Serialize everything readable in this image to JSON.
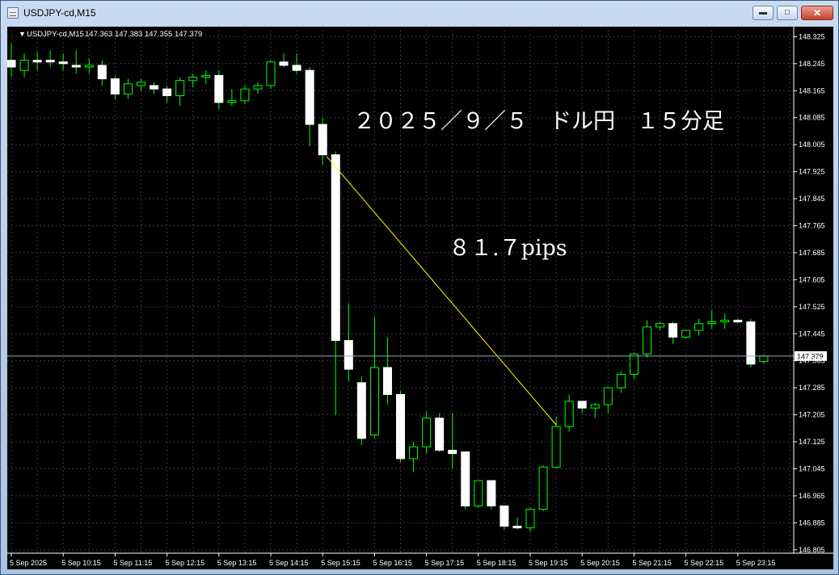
{
  "window": {
    "title": "USDJPY-cd,M15",
    "buttons": {
      "minimize": "▬",
      "maximize": "□",
      "close": "✕"
    }
  },
  "chart_data": {
    "type": "candlestick",
    "symbol_label": "USDJPY-cd,M15",
    "ohlc_header": "147.363 147.383 147.355 147.379",
    "title": "２０２５／９／５　ドル円　１５分足",
    "annotation": "８１.７pips",
    "current_price_label": "147.379",
    "current_price": 147.379,
    "ylim": [
      146.795,
      148.345
    ],
    "y_ticks": [
      "148.325",
      "148.245",
      "148.165",
      "148.085",
      "148.005",
      "147.925",
      "147.845",
      "147.765",
      "147.685",
      "147.605",
      "147.525",
      "147.445",
      "147.365",
      "147.285",
      "147.205",
      "147.125",
      "147.045",
      "146.965",
      "146.885",
      "146.805"
    ],
    "x_ticks": [
      "5 Sep 2025",
      "5 Sep 10:15",
      "5 Sep 11:15",
      "5 Sep 12:15",
      "5 Sep 13:15",
      "5 Sep 14:15",
      "5 Sep 15:15",
      "5 Sep 16:15",
      "5 Sep 17:15",
      "5 Sep 18:15",
      "5 Sep 19:15",
      "5 Sep 20:15",
      "5 Sep 21:15",
      "5 Sep 22:15",
      "5 Sep 23:15"
    ],
    "trendline": {
      "from": [
        24,
        147.97
      ],
      "to": [
        42,
        147.175
      ],
      "color": "#ffff00"
    },
    "colors": {
      "background": "#000000",
      "grid": "#3a3a3a",
      "bull_wick": "#00ff00",
      "bear_wick": "#00ff00",
      "body_up": "#000000",
      "body_down": "#ffffff",
      "axis_text": "#ffffff",
      "price_line": "#8fa9c4"
    },
    "candles": [
      {
        "o": 148.255,
        "h": 148.305,
        "l": 148.205,
        "c": 148.235
      },
      {
        "o": 148.225,
        "h": 148.275,
        "l": 148.205,
        "c": 148.255
      },
      {
        "o": 148.255,
        "h": 148.28,
        "l": 148.225,
        "c": 148.25
      },
      {
        "o": 148.255,
        "h": 148.285,
        "l": 148.235,
        "c": 148.25
      },
      {
        "o": 148.25,
        "h": 148.275,
        "l": 148.225,
        "c": 148.245
      },
      {
        "o": 148.24,
        "h": 148.285,
        "l": 148.215,
        "c": 148.235
      },
      {
        "o": 148.235,
        "h": 148.26,
        "l": 148.215,
        "c": 148.24
      },
      {
        "o": 148.24,
        "h": 148.255,
        "l": 148.18,
        "c": 148.2
      },
      {
        "o": 148.2,
        "h": 148.21,
        "l": 148.14,
        "c": 148.155
      },
      {
        "o": 148.155,
        "h": 148.2,
        "l": 148.14,
        "c": 148.185
      },
      {
        "o": 148.18,
        "h": 148.2,
        "l": 148.165,
        "c": 148.19
      },
      {
        "o": 148.18,
        "h": 148.19,
        "l": 148.155,
        "c": 148.17
      },
      {
        "o": 148.17,
        "h": 148.18,
        "l": 148.13,
        "c": 148.15
      },
      {
        "o": 148.15,
        "h": 148.205,
        "l": 148.12,
        "c": 148.195
      },
      {
        "o": 148.195,
        "h": 148.215,
        "l": 148.175,
        "c": 148.205
      },
      {
        "o": 148.205,
        "h": 148.225,
        "l": 148.185,
        "c": 148.21
      },
      {
        "o": 148.21,
        "h": 148.225,
        "l": 148.11,
        "c": 148.13
      },
      {
        "o": 148.13,
        "h": 148.17,
        "l": 148.12,
        "c": 148.135
      },
      {
        "o": 148.135,
        "h": 148.18,
        "l": 148.125,
        "c": 148.17
      },
      {
        "o": 148.17,
        "h": 148.19,
        "l": 148.155,
        "c": 148.18
      },
      {
        "o": 148.18,
        "h": 148.255,
        "l": 148.17,
        "c": 148.25
      },
      {
        "o": 148.25,
        "h": 148.275,
        "l": 148.235,
        "c": 148.24
      },
      {
        "o": 148.24,
        "h": 148.275,
        "l": 148.215,
        "c": 148.225
      },
      {
        "o": 148.225,
        "h": 148.235,
        "l": 148.0,
        "c": 148.065
      },
      {
        "o": 148.065,
        "h": 148.085,
        "l": 147.945,
        "c": 147.975
      },
      {
        "o": 147.975,
        "h": 147.985,
        "l": 147.205,
        "c": 147.425
      },
      {
        "o": 147.425,
        "h": 147.535,
        "l": 147.305,
        "c": 147.34
      },
      {
        "o": 147.3,
        "h": 147.32,
        "l": 147.115,
        "c": 147.135
      },
      {
        "o": 147.145,
        "h": 147.495,
        "l": 147.135,
        "c": 147.345
      },
      {
        "o": 147.345,
        "h": 147.435,
        "l": 147.235,
        "c": 147.265
      },
      {
        "o": 147.265,
        "h": 147.275,
        "l": 147.065,
        "c": 147.075
      },
      {
        "o": 147.075,
        "h": 147.125,
        "l": 147.035,
        "c": 147.11
      },
      {
        "o": 147.11,
        "h": 147.215,
        "l": 147.09,
        "c": 147.195
      },
      {
        "o": 147.195,
        "h": 147.21,
        "l": 147.095,
        "c": 147.1
      },
      {
        "o": 147.1,
        "h": 147.21,
        "l": 147.045,
        "c": 147.09
      },
      {
        "o": 147.095,
        "h": 147.095,
        "l": 146.925,
        "c": 146.935
      },
      {
        "o": 146.935,
        "h": 147.005,
        "l": 146.93,
        "c": 147.01
      },
      {
        "o": 147.01,
        "h": 147.005,
        "l": 146.925,
        "c": 146.935
      },
      {
        "o": 146.935,
        "h": 146.935,
        "l": 146.865,
        "c": 146.875
      },
      {
        "o": 146.875,
        "h": 146.9,
        "l": 146.865,
        "c": 146.87
      },
      {
        "o": 146.87,
        "h": 146.93,
        "l": 146.86,
        "c": 146.925
      },
      {
        "o": 146.925,
        "h": 147.055,
        "l": 146.92,
        "c": 147.05
      },
      {
        "o": 147.05,
        "h": 147.2,
        "l": 147.045,
        "c": 147.17
      },
      {
        "o": 147.17,
        "h": 147.265,
        "l": 147.155,
        "c": 147.245
      },
      {
        "o": 147.245,
        "h": 147.235,
        "l": 147.21,
        "c": 147.225
      },
      {
        "o": 147.225,
        "h": 147.24,
        "l": 147.195,
        "c": 147.235
      },
      {
        "o": 147.235,
        "h": 147.285,
        "l": 147.21,
        "c": 147.285
      },
      {
        "o": 147.285,
        "h": 147.335,
        "l": 147.27,
        "c": 147.325
      },
      {
        "o": 147.325,
        "h": 147.39,
        "l": 147.31,
        "c": 147.385
      },
      {
        "o": 147.385,
        "h": 147.485,
        "l": 147.375,
        "c": 147.465
      },
      {
        "o": 147.465,
        "h": 147.48,
        "l": 147.455,
        "c": 147.475
      },
      {
        "o": 147.475,
        "h": 147.48,
        "l": 147.415,
        "c": 147.435
      },
      {
        "o": 147.435,
        "h": 147.455,
        "l": 147.43,
        "c": 147.455
      },
      {
        "o": 147.455,
        "h": 147.49,
        "l": 147.44,
        "c": 147.475
      },
      {
        "o": 147.475,
        "h": 147.515,
        "l": 147.46,
        "c": 147.48
      },
      {
        "o": 147.48,
        "h": 147.505,
        "l": 147.46,
        "c": 147.485
      },
      {
        "o": 147.485,
        "h": 147.49,
        "l": 147.475,
        "c": 147.48
      },
      {
        "o": 147.48,
        "h": 147.49,
        "l": 147.345,
        "c": 147.355
      },
      {
        "o": 147.363,
        "h": 147.383,
        "l": 147.355,
        "c": 147.379
      }
    ]
  }
}
